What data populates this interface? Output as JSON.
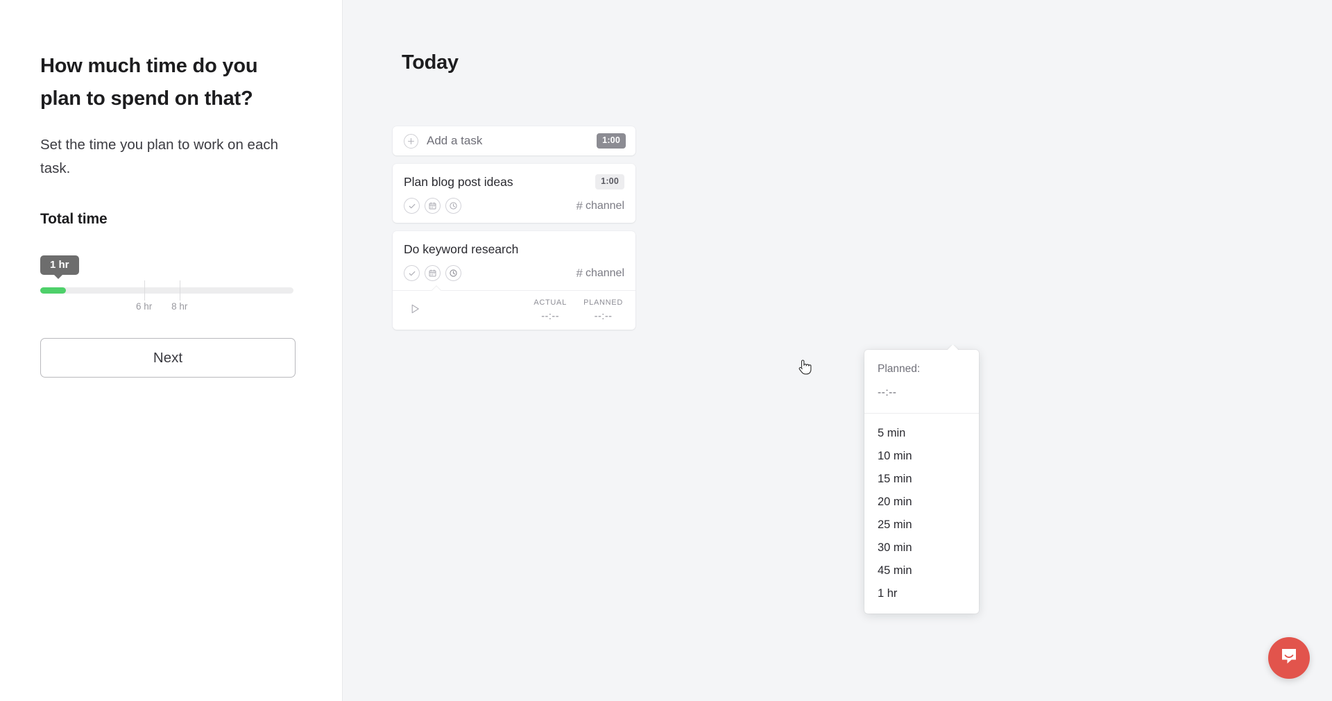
{
  "left": {
    "headline": "How much time do you plan to spend on that?",
    "subhead": "Set the time you plan to work on each task.",
    "total_time_label": "Total time",
    "slider": {
      "value_label": "1 hr",
      "fill_percent": 10,
      "ticks": [
        {
          "label": "6 hr",
          "percent": 41
        },
        {
          "label": "8 hr",
          "percent": 55
        }
      ]
    },
    "next_label": "Next"
  },
  "right": {
    "title": "Today",
    "add_task": {
      "label": "Add a task",
      "badge": "1:00",
      "icon": "plus-circle-icon"
    },
    "tasks": [
      {
        "title": "Plan blog post ideas",
        "badge": "1:00",
        "channel": "channel",
        "hash": "#",
        "icons": [
          "check-circle-icon",
          "calendar-icon",
          "clock-icon"
        ],
        "expanded": false
      },
      {
        "title": "Do keyword research",
        "badge": "",
        "channel": "channel",
        "hash": "#",
        "icons": [
          "check-circle-icon",
          "calendar-icon",
          "clock-icon"
        ],
        "expanded": true
      }
    ],
    "timer": {
      "play_icon": "play-icon",
      "actual_label": "ACTUAL",
      "actual_value": "--:--",
      "planned_label": "PLANNED",
      "planned_value": "--:--"
    },
    "dropdown": {
      "header_label": "Planned:",
      "header_value": "--:--",
      "options": [
        "5 min",
        "10 min",
        "15 min",
        "20 min",
        "25 min",
        "30 min",
        "45 min",
        "1 hr"
      ]
    },
    "intercom": {
      "icon": "intercom-chat-icon"
    }
  },
  "colors": {
    "slider_fill": "#4ed06a",
    "bubble": "#6d6d6d",
    "badge_dark": "#8c8c93",
    "badge_light": "#ededef",
    "panel_bg": "#f4f5f7",
    "intercom": "#e2544c"
  }
}
